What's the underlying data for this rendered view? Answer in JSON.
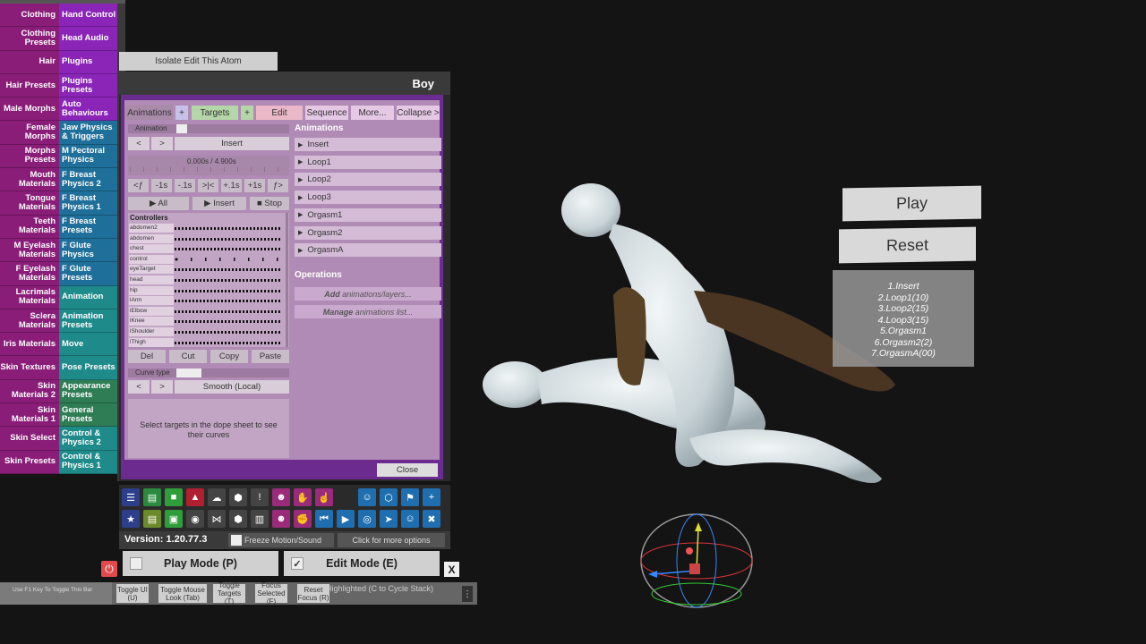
{
  "left_menu": [
    {
      "left": "Clothing",
      "right": "Hand Control",
      "lc": "magenta",
      "rc": "purple"
    },
    {
      "left": "Clothing Presets",
      "right": "Head Audio",
      "lc": "magenta",
      "rc": "purple"
    },
    {
      "left": "Hair",
      "right": "Plugins",
      "lc": "magenta",
      "rc": "purple"
    },
    {
      "left": "Hair Presets",
      "right": "Plugins Presets",
      "lc": "magenta",
      "rc": "purple"
    },
    {
      "left": "Male Morphs",
      "right": "Auto Behaviours",
      "lc": "magenta",
      "rc": "purple"
    },
    {
      "left": "Female Morphs",
      "right": "Jaw Physics & Triggers",
      "lc": "magenta",
      "rc": "blue"
    },
    {
      "left": "Morphs Presets",
      "right": "M Pectoral Physics",
      "lc": "magenta",
      "rc": "blue"
    },
    {
      "left": "Mouth Materials",
      "right": "F Breast Physics 2",
      "lc": "magenta",
      "rc": "blue"
    },
    {
      "left": "Tongue Materials",
      "right": "F Breast Physics 1",
      "lc": "magenta",
      "rc": "blue"
    },
    {
      "left": "Teeth Materials",
      "right": "F Breast Presets",
      "lc": "magenta",
      "rc": "blue"
    },
    {
      "left": "M Eyelash Materials",
      "right": "F Glute Physics",
      "lc": "magenta",
      "rc": "blue"
    },
    {
      "left": "F Eyelash Materials",
      "right": "F Glute Presets",
      "lc": "magenta",
      "rc": "blue"
    },
    {
      "left": "Lacrimals Materials",
      "right": "Animation",
      "lc": "magenta",
      "rc": "teal"
    },
    {
      "left": "Sclera Materials",
      "right": "Animation Presets",
      "lc": "magenta",
      "rc": "teal"
    },
    {
      "left": "Iris Materials",
      "right": "Move",
      "lc": "magenta",
      "rc": "teal"
    },
    {
      "left": "Skin Textures",
      "right": "Pose Presets",
      "lc": "magenta",
      "rc": "teal"
    },
    {
      "left": "Skin Materials 2",
      "right": "Appearance Presets",
      "lc": "magenta",
      "rc": "green"
    },
    {
      "left": "Skin Materials 1",
      "right": "General Presets",
      "lc": "magenta",
      "rc": "green"
    },
    {
      "left": "Skin Select",
      "right": "Control & Physics 2",
      "lc": "magenta",
      "rc": "teal"
    },
    {
      "left": "Skin Presets",
      "right": "Control & Physics 1",
      "lc": "magenta",
      "rc": "teal"
    }
  ],
  "isolate_label": "Isolate Edit This Atom",
  "panel_title": "Boy",
  "tabs": {
    "animations": "Animations",
    "plus1": "+",
    "targets": "Targets",
    "plus2": "+",
    "edit": "Edit",
    "sequence": "Sequence",
    "more": "More...",
    "collapse": "Collapse >"
  },
  "animation_label": "Animation",
  "prev": "<",
  "next": ">",
  "current_animation": "Insert",
  "time_display": "0.000s / 4.900s",
  "step_buttons": [
    "<ƒ",
    "-1s",
    "-.1s",
    ">|<",
    "+.1s",
    "+1s",
    "ƒ>"
  ],
  "play_all": "▶  All",
  "play_insert": "▶  Insert",
  "stop": "■ Stop",
  "controllers_label": "Controllers",
  "controllers": [
    "abdomen2",
    "abdomen",
    "chest",
    "control",
    "eyeTarget",
    "head",
    "hip",
    "lArm",
    "lElbow",
    "lKnee",
    "lShoulder",
    "lThigh"
  ],
  "edit_buttons": {
    "del": "Del",
    "cut": "Cut",
    "copy": "Copy",
    "paste": "Paste"
  },
  "curve_type_label": "Curve type",
  "curve_type_value": "Smooth (Local)",
  "dope_hint": "Select targets in the dope sheet to see their curves",
  "animations_header": "Animations",
  "animations": [
    "Insert",
    "Loop1",
    "Loop2",
    "Loop3",
    "Orgasm1",
    "Orgasm2",
    "OrgasmA"
  ],
  "operations_header": "Operations",
  "operations": [
    {
      "bold": "Add",
      "rest": " animations/layers..."
    },
    {
      "bold": "Manage",
      "rest": " animations list..."
    }
  ],
  "close_label": "Close",
  "version": "Version: 1.20.77.3",
  "freeze_label": "Freeze Motion/Sound",
  "more_options": "Click for more options",
  "play_mode": "Play Mode (P)",
  "edit_mode": "Edit Mode (E)",
  "edit_mode_check": "✓",
  "x_label": "X",
  "f1_hint": "Use F1 Key To Toggle This Bar",
  "bottom_buttons": [
    "Toggle UI (U)",
    "Toggle Mouse Look (Tab)",
    "Toggle Targets (T)",
    "Focus Selected (F)",
    "Reset Focus (R)"
  ],
  "highlighted": "Highlighted (C to Cycle Stack)",
  "kebab": "⋮",
  "world_play": "Play",
  "world_reset": "Reset",
  "sequence_list": [
    "1.Insert",
    "2.Loop1(10)",
    "3.Loop2(15)",
    "4.Loop3(15)",
    "5.Orgasm1",
    "6.Orgasm2(2)",
    "7.OrgasmA(00)"
  ],
  "toolbar_icons_row1": [
    {
      "name": "menu-icon",
      "glyph": "☰",
      "color": "#2d3f8a"
    },
    {
      "name": "save-scene-icon",
      "glyph": "▤",
      "color": "#2b8a3e"
    },
    {
      "name": "open-folder-icon",
      "glyph": "■",
      "color": "#2f9d3a"
    },
    {
      "name": "load-look-icon",
      "glyph": "▲",
      "color": "#b02030"
    },
    {
      "name": "cloud-icon",
      "glyph": "☁",
      "color": "#444"
    },
    {
      "name": "package-icon",
      "glyph": "⬢",
      "color": "#444"
    },
    {
      "name": "alert-icon",
      "glyph": "!",
      "color": "#444"
    },
    {
      "name": "person-settings-icon",
      "glyph": "☻",
      "color": "#9a2a7a"
    },
    {
      "name": "hand-icon",
      "glyph": "✋",
      "color": "#9a2a7a"
    },
    {
      "name": "hand-point-icon",
      "glyph": "☝",
      "color": "#9a2a7a"
    },
    {
      "name": "gap",
      "glyph": "",
      "color": "transparent"
    },
    {
      "name": "person-icon",
      "glyph": "☺",
      "color": "#1f6fb0"
    },
    {
      "name": "unity-icon",
      "glyph": "⬡",
      "color": "#1f6fb0"
    },
    {
      "name": "flag-icon",
      "glyph": "⚑",
      "color": "#1f6fb0"
    },
    {
      "name": "add-icon",
      "glyph": "+",
      "color": "#1f6fb0"
    }
  ],
  "toolbar_icons_row2": [
    {
      "name": "star-icon",
      "glyph": "★",
      "color": "#2d3f8a"
    },
    {
      "name": "quick-save-icon",
      "glyph": "▤",
      "color": "#6a8a2b"
    },
    {
      "name": "screenshot-folder-icon",
      "glyph": "▣",
      "color": "#2f9d3a"
    },
    {
      "name": "camera-icon",
      "glyph": "◉",
      "color": "#444"
    },
    {
      "name": "graph-icon",
      "glyph": "⋈",
      "color": "#444"
    },
    {
      "name": "packages-icon",
      "glyph": "⬢",
      "color": "#444"
    },
    {
      "name": "document-icon",
      "glyph": "▥",
      "color": "#444"
    },
    {
      "name": "person-card-icon",
      "glyph": "☻",
      "color": "#9a2a7a"
    },
    {
      "name": "hand-pose-icon",
      "glyph": "✊",
      "color": "#9a2a7a"
    },
    {
      "name": "skip-back-icon",
      "glyph": "⏮",
      "color": "#1f6fb0"
    },
    {
      "name": "play-icon",
      "glyph": "▶",
      "color": "#1f6fb0"
    },
    {
      "name": "target-icon",
      "glyph": "◎",
      "color": "#1f6fb0"
    },
    {
      "name": "pointer-icon",
      "glyph": "➤",
      "color": "#1f6fb0"
    },
    {
      "name": "people-icon",
      "glyph": "☺",
      "color": "#1f6fb0"
    },
    {
      "name": "tools-icon",
      "glyph": "✖",
      "color": "#1f6fb0"
    }
  ]
}
